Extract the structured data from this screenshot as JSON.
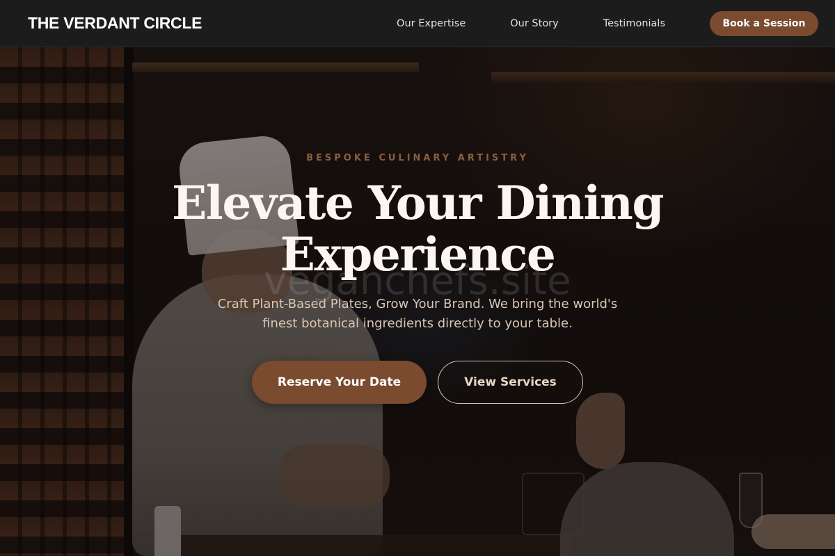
{
  "nav": {
    "brand": "THE VERDANT CIRCLE",
    "links": [
      {
        "label": "Our Expertise"
      },
      {
        "label": "Our Story"
      },
      {
        "label": "Testimonials"
      }
    ],
    "cta_label": "Book a Session"
  },
  "hero": {
    "eyebrow": "BESPOKE CULINARY ARTISTRY",
    "headline_line1": "Elevate Your Dining",
    "headline_line2": "Experience",
    "watermark": "veganchefs.site",
    "subtitle_line1": "Craft Plant-Based Plates, Grow Your Brand. We bring the world's",
    "subtitle_line2": "finest botanical ingredients directly to your table.",
    "primary_button": "Reserve Your Date",
    "secondary_button": "View Services"
  },
  "colors": {
    "accent_brown": "#7a4b2e",
    "eyebrow": "#8a5e3e",
    "nav_background": "#1c1c1c",
    "headline": "#fbf6ef",
    "subtitle": "#d9c7b5"
  },
  "background_image": "chef-serving-guest-restaurant-photo"
}
